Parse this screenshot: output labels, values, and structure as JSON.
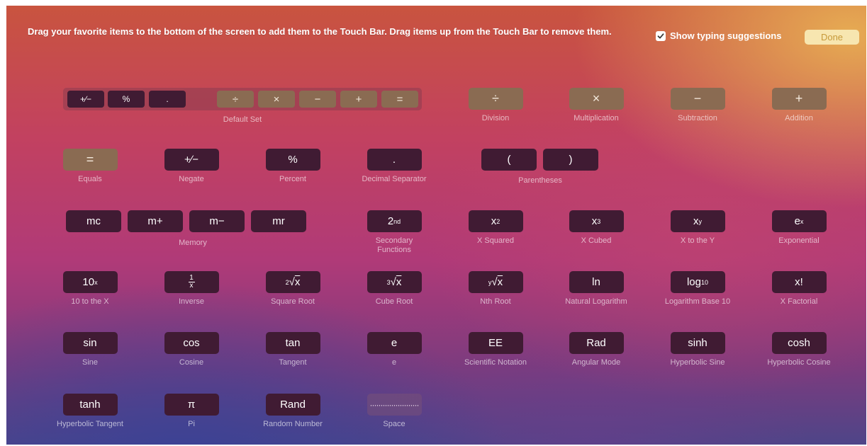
{
  "header": {
    "instruction": "Drag your favorite items to the bottom of the screen to add them to the Touch Bar. Drag items up from the Touch Bar to remove them.",
    "show_typing_suggestions_label": "Show typing suggestions",
    "show_typing_suggestions_checked": true,
    "done_label": "Done"
  },
  "default_set": {
    "label": "Default Set",
    "keys": [
      "+∕−",
      "%",
      ".",
      "÷",
      "×",
      "−",
      "+",
      "="
    ]
  },
  "ops": [
    {
      "symbol": "÷",
      "label": "Division"
    },
    {
      "symbol": "×",
      "label": "Multiplication"
    },
    {
      "symbol": "−",
      "label": "Subtraction"
    },
    {
      "symbol": "+",
      "label": "Addition"
    }
  ],
  "row2": [
    {
      "symbol": "=",
      "label": "Equals"
    },
    {
      "symbol": "+∕−",
      "label": "Negate"
    },
    {
      "symbol": "%",
      "label": "Percent"
    },
    {
      "symbol": ".",
      "label": "Decimal Separator"
    }
  ],
  "parentheses": {
    "open": "(",
    "close": ")",
    "label": "Parentheses"
  },
  "memory": {
    "keys": [
      "mc",
      "m+",
      "m−",
      "mr"
    ],
    "label": "Memory"
  },
  "row3": [
    {
      "label": "Secondary Functions"
    },
    {
      "label": "X Squared"
    },
    {
      "label": "X Cubed"
    },
    {
      "label": "X to the Y"
    },
    {
      "label": "Exponential"
    }
  ],
  "row4": [
    {
      "label": "10 to the X"
    },
    {
      "label": "Inverse"
    },
    {
      "label": "Square Root"
    },
    {
      "label": "Cube Root"
    },
    {
      "label": "Nth Root"
    },
    {
      "symbol": "ln",
      "label": "Natural Logarithm"
    },
    {
      "label": "Logarithm Base 10"
    },
    {
      "symbol": "x!",
      "label": "X Factorial"
    }
  ],
  "row5": [
    {
      "symbol": "sin",
      "label": "Sine"
    },
    {
      "symbol": "cos",
      "label": "Cosine"
    },
    {
      "symbol": "tan",
      "label": "Tangent"
    },
    {
      "symbol": "e",
      "label": "e"
    },
    {
      "symbol": "EE",
      "label": "Scientific Notation"
    },
    {
      "symbol": "Rad",
      "label": "Angular Mode"
    },
    {
      "symbol": "sinh",
      "label": "Hyperbolic Sine"
    },
    {
      "symbol": "cosh",
      "label": "Hyperbolic Cosine"
    }
  ],
  "row6": [
    {
      "symbol": "tanh",
      "label": "Hyperbolic Tangent"
    },
    {
      "symbol": "π",
      "label": "Pi"
    },
    {
      "symbol": "Rand",
      "label": "Random Number"
    },
    {
      "symbol": "·······················",
      "label": "Space"
    }
  ]
}
